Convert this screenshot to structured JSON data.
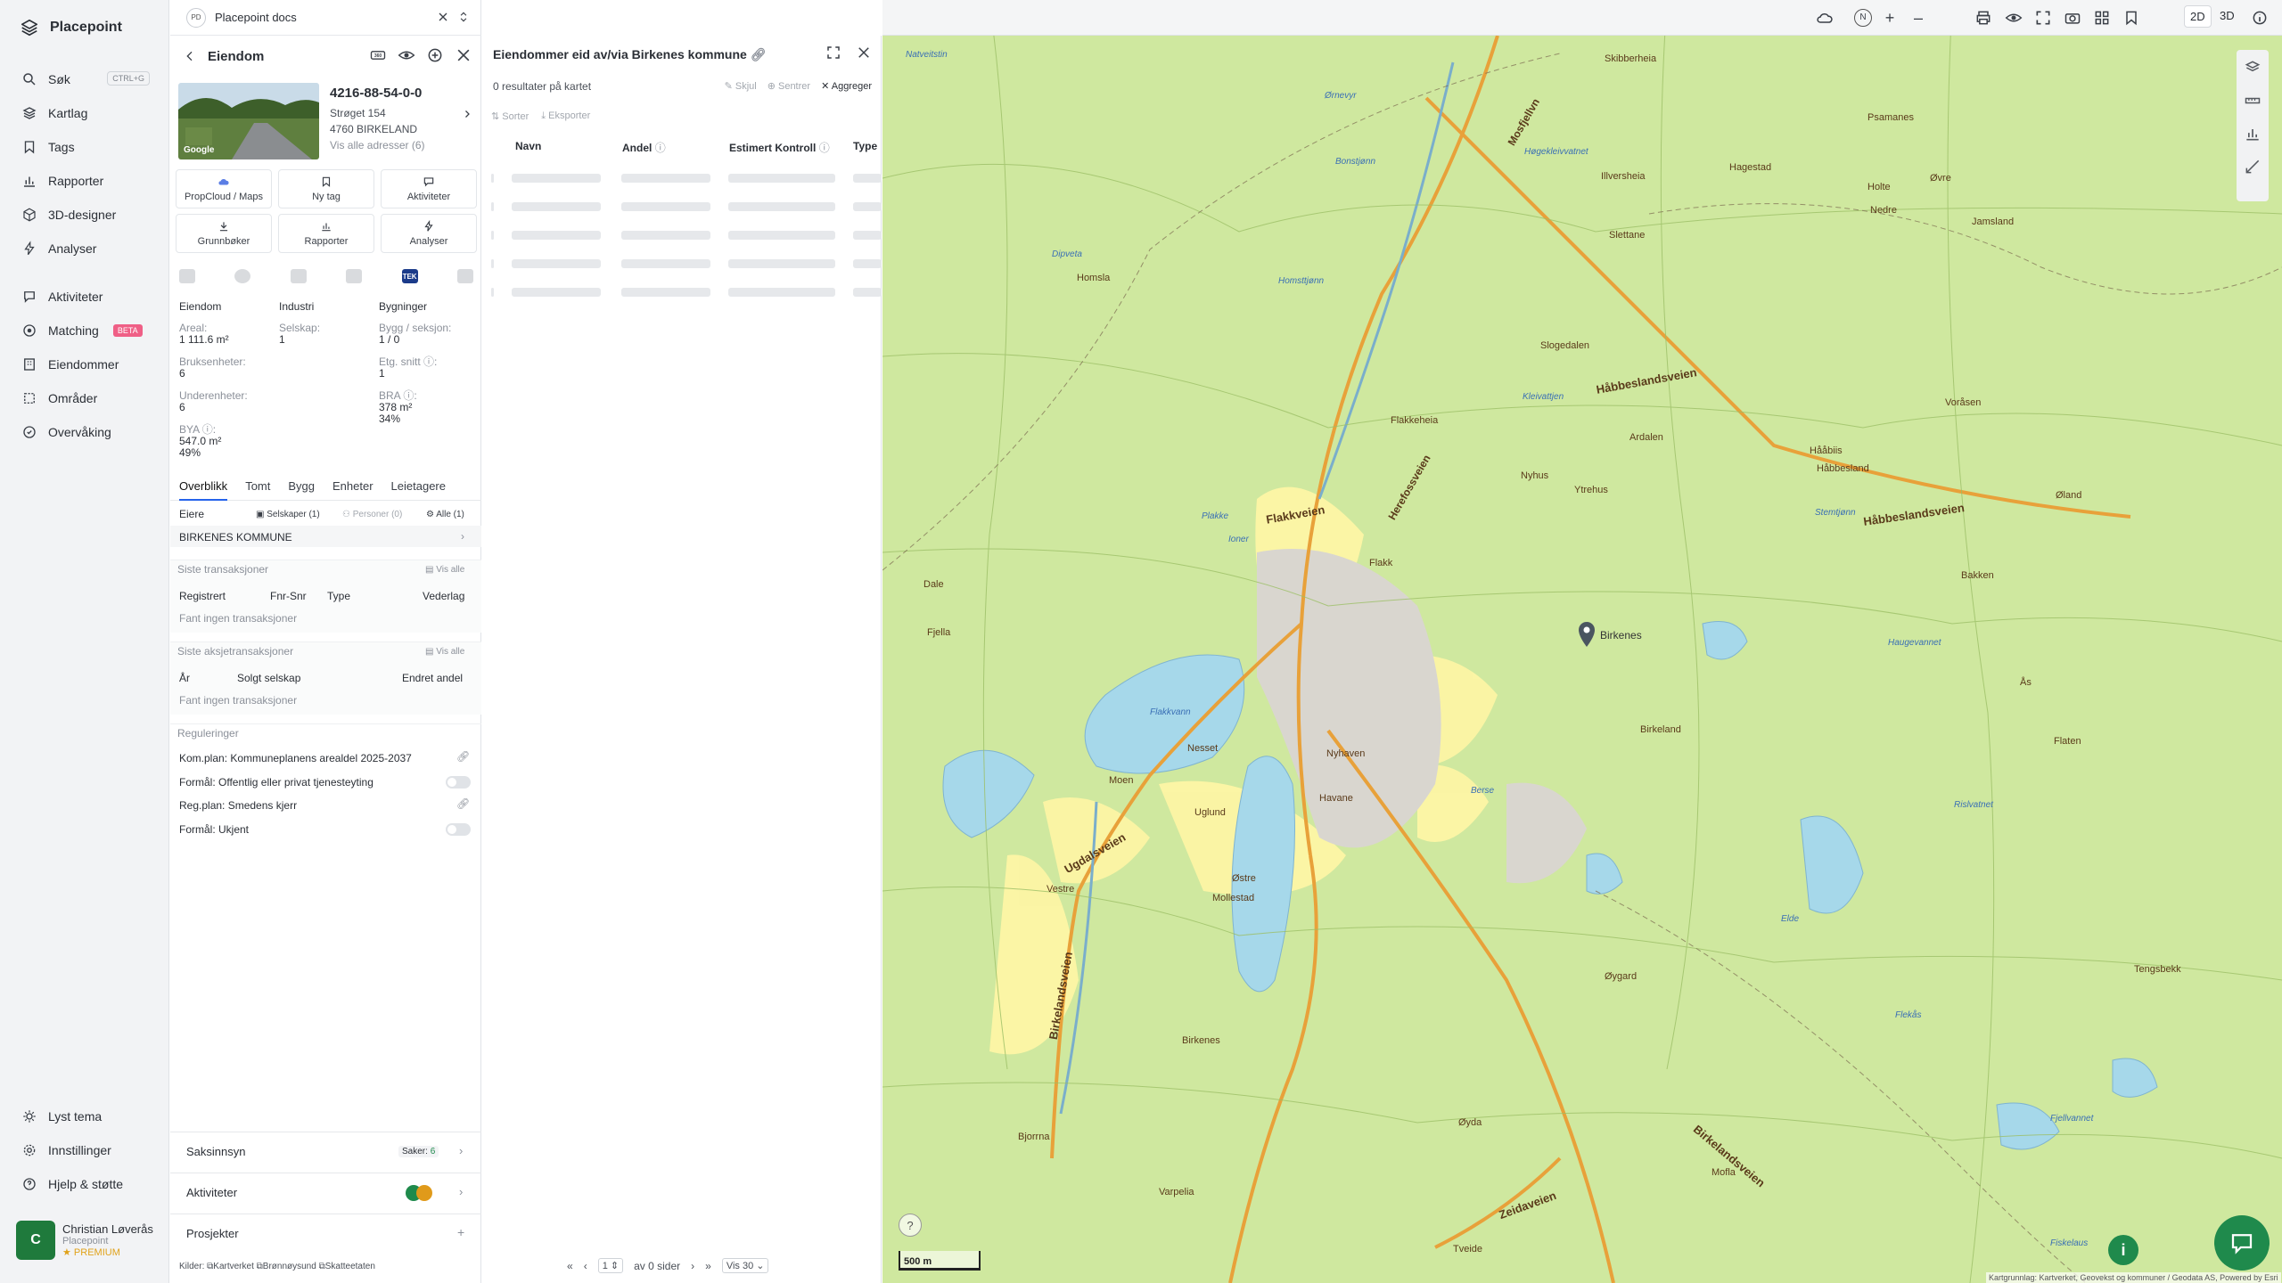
{
  "sidebar": {
    "brand": "Placepoint",
    "nav_top": [
      {
        "label": "Søk",
        "shortcut": "CTRL+G"
      },
      {
        "label": "Kartlag"
      },
      {
        "label": "Tags"
      },
      {
        "label": "Rapporter"
      },
      {
        "label": "3D-designer"
      },
      {
        "label": "Analyser"
      }
    ],
    "nav_mid": [
      {
        "label": "Aktiviteter"
      },
      {
        "label": "Matching",
        "badge": "BETA"
      },
      {
        "label": "Eiendommer"
      },
      {
        "label": "Områder"
      },
      {
        "label": "Overvåking"
      }
    ],
    "nav_bottom": [
      {
        "label": "Lyst tema"
      },
      {
        "label": "Innstillinger"
      },
      {
        "label": "Hjelp & støtte"
      }
    ],
    "user": {
      "initial": "C",
      "name": "Christian Løverås",
      "org": "Placepoint",
      "plan": "PREMIUM"
    }
  },
  "docs_bar": {
    "badge": "PD",
    "title": "Placepoint docs"
  },
  "property": {
    "heading": "Eiendom",
    "photo_label": "Google",
    "id": "4216-88-54-0-0",
    "street": "Strøget 154",
    "city": "4760 BIRKELAND",
    "all_addresses": "Vis alle adresser (6)",
    "actions": [
      "PropCloud / Maps",
      "Ny tag",
      "Aktiviteter",
      "Grunnbøker",
      "Rapporter",
      "Analyser"
    ],
    "layer_badge": "TEK",
    "stats": {
      "c1_title": "Eiendom",
      "c2_title": "Industri",
      "c3_title": "Bygninger",
      "areal_label": "Areal:",
      "areal_value": "1 111.6 m²",
      "selskap_label": "Selskap:",
      "selskap_value": "1",
      "bygg_label": "Bygg / seksjon:",
      "bygg_value": "1 / 0",
      "bruks_label": "Bruksenheter:",
      "bruks_value": "6",
      "etg_label": "Etg. snitt ⓘ:",
      "etg_value": "1",
      "under_label": "Underenheter:",
      "under_value": "6",
      "bra_label": "BRA ⓘ:",
      "bra_value": "378 m²",
      "bra_pct": "34%",
      "bya_label": "BYA ⓘ:",
      "bya_value": "547.0 m²",
      "bya_pct": "49%"
    },
    "tabs": [
      "Overblikk",
      "Tomt",
      "Bygg",
      "Enheter",
      "Leietagere"
    ],
    "owners": {
      "label": "Eiere",
      "filters": [
        "Selskaper (1)",
        "Personer (0)",
        "Alle (1)"
      ],
      "owner": "BIRKENES KOMMUNE"
    },
    "transactions": {
      "title": "Siste transaksjoner",
      "show_all": "Vis alle",
      "cols": [
        "Registrert",
        "Fnr-Snr",
        "Type",
        "Vederlag"
      ],
      "empty": "Fant ingen transaksjoner"
    },
    "stock_tx": {
      "title": "Siste aksjetransaksjoner",
      "show_all": "Vis alle",
      "cols": [
        "År",
        "Solgt selskap",
        "Endret andel"
      ],
      "empty": "Fant ingen transaksjoner"
    },
    "regulations": {
      "title": "Reguleringer",
      "items": [
        "Kom.plan: Kommuneplanens arealdel 2025-2037",
        "Formål: Offentlig eller privat tjenesteyting",
        "Reg.plan: Smedens kjerr",
        "Formål: Ukjent"
      ]
    },
    "bottom": {
      "saksinnsyn": "Saksinnsyn",
      "saker_label": "Saker:",
      "saker_count": "6",
      "aktiviteter": "Aktiviteter",
      "prosjekter": "Prosjekter"
    },
    "sources_label": "Kilder:",
    "sources": [
      "Kartverket",
      "Brønnøysund",
      "Skatteetaten"
    ]
  },
  "owned": {
    "title": "Eiendommer eid av/via Birkenes kommune",
    "results": "0 resultater på kartet",
    "actions": [
      "Skjul",
      "Sentrer",
      "Aggreger"
    ],
    "sub_actions": [
      "Sorter",
      "Eksporter"
    ],
    "columns": [
      "Navn",
      "Andel",
      "Estimert Kontroll",
      "Type"
    ],
    "pager": {
      "page": "1",
      "of_pages": "av 0 sider",
      "per_page": "Vis 30"
    }
  },
  "map": {
    "view_2d": "2D",
    "view_3d": "3D",
    "scale": "500 m",
    "attribution": "Kartgrunnlag: Kartverket, Geovekst og kommuner / Geodata AS, Powered by Esri",
    "place_names": [
      "Skibberheia",
      "Psamanes",
      "Hagestad",
      "Holte",
      "Nedre",
      "Jamsland",
      "Øvre",
      "Illversheia",
      "Slettane",
      "Slogedalen",
      "Flakkeheia",
      "Ardalen",
      "Voråsen",
      "Hååbiis",
      "Håbbesland",
      "Øland",
      "Nyhus",
      "Flakk",
      "Ytrehus",
      "Bakken",
      "Dale",
      "Fjella",
      "Homsla",
      "Nyhaven",
      "Moen",
      "Havane",
      "Uglund",
      "Østre",
      "Mollestad",
      "Vestre",
      "Birkeland",
      "Birkenes",
      "Bjorrna",
      "Varpelia",
      "Øyda",
      "Tveide",
      "Øygard",
      "Mofla",
      "Tengsbekk",
      "Flaten",
      "Ås",
      "Nesset"
    ],
    "water_names": [
      "Natveitstin",
      "Ørnevyr",
      "Bonstjønn",
      "Høgekleivvatnet",
      "Kleivattjen",
      "Plakke",
      "Ioner",
      "Flakkvann",
      "Berse",
      "Stemtjønn",
      "Haugevannet",
      "Rislvatnet",
      "Elde",
      "Flekås",
      "Fjellvannet",
      "Fiskelaus",
      "Dipveta",
      "Homsttjønn"
    ],
    "road_names": [
      "Mosfjellvn",
      "Håbbeslandsveien",
      "Flakkveien",
      "Herefossveien",
      "Ugdalsveien",
      "Birkelandsveien",
      "Zeidaveien"
    ],
    "marker_label": "Birkenes"
  }
}
